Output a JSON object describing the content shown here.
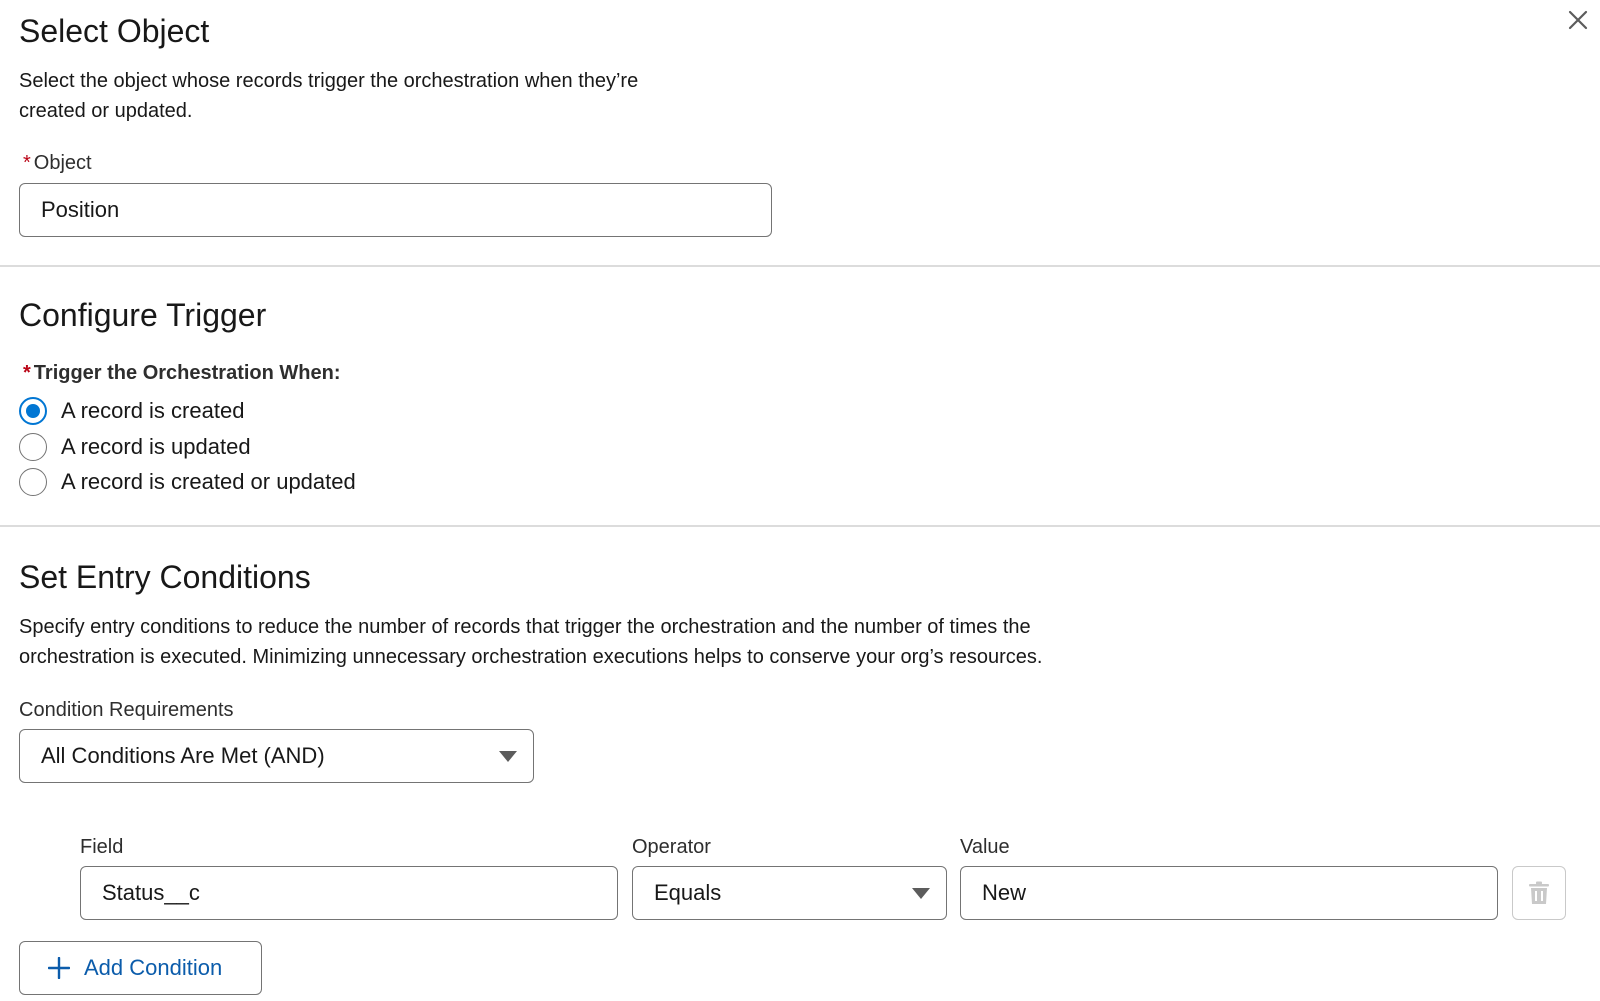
{
  "select_object": {
    "title": "Select Object",
    "description_line1": "Select the object whose records trigger the orchestration when they’re",
    "description_line2": "created or updated.",
    "object_required_mark": "*",
    "object_label": "Object",
    "object_value": "Position"
  },
  "configure_trigger": {
    "title": "Configure Trigger",
    "required_mark": "*",
    "question": "Trigger the Orchestration When:",
    "options": [
      {
        "label": "A record is created",
        "selected": true
      },
      {
        "label": "A record is updated",
        "selected": false
      },
      {
        "label": "A record is created or updated",
        "selected": false
      }
    ]
  },
  "entry_conditions": {
    "title": "Set Entry Conditions",
    "description_line1": "Specify entry conditions to reduce the number of records that trigger the orchestration and the number of times the",
    "description_line2": "orchestration is executed. Minimizing unnecessary orchestration executions helps to conserve your org’s resources.",
    "requirements_label": "Condition Requirements",
    "requirements_value": "All Conditions Are Met (AND)",
    "field_label": "Field",
    "operator_label": "Operator",
    "value_label": "Value",
    "conditions": [
      {
        "field": "Status__c",
        "operator": "Equals",
        "value": "New"
      }
    ],
    "add_condition_label": "Add Condition"
  },
  "icons": {
    "close": "close-icon",
    "delete": "trash-icon",
    "add": "plus-icon",
    "dropdown": "chevron-down-icon"
  },
  "colors": {
    "accent": "#0176d3",
    "link": "#0b5cab",
    "required": "#ba0517",
    "border": "#747474",
    "divider": "#dcdcdc"
  }
}
